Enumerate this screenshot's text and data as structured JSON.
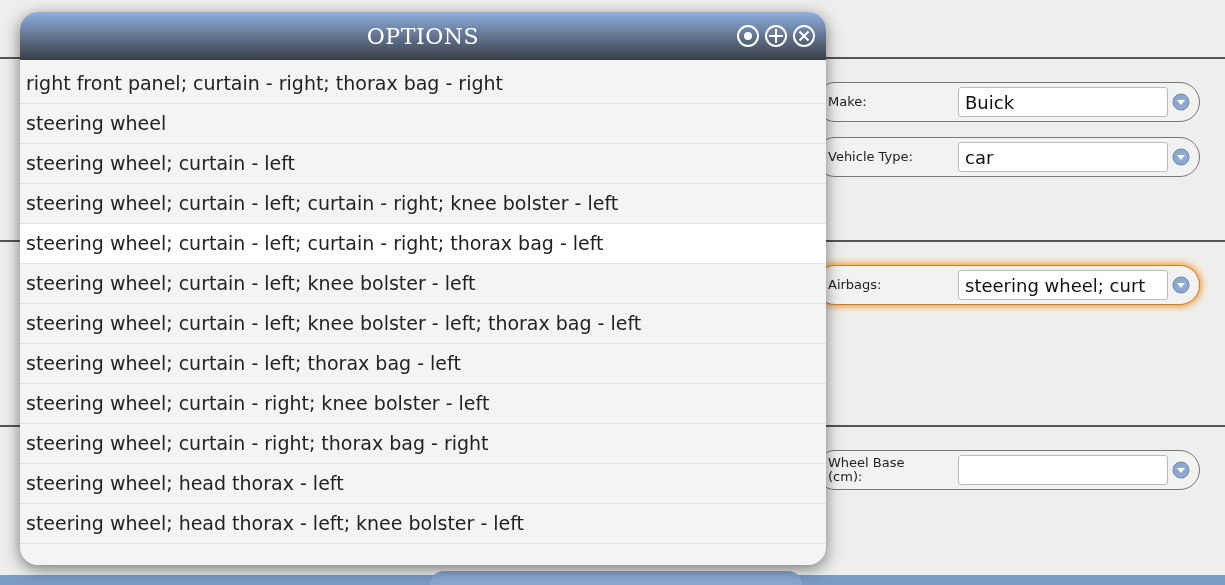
{
  "dialog": {
    "title": "OPTIONS",
    "items": [
      {
        "label": "right front panel; curtain - right; thorax bag - right",
        "selected": false
      },
      {
        "label": "steering wheel",
        "selected": false
      },
      {
        "label": "steering wheel; curtain - left",
        "selected": false
      },
      {
        "label": "steering wheel; curtain - left; curtain - right; knee bolster - left",
        "selected": false
      },
      {
        "label": "steering wheel; curtain - left; curtain - right; thorax bag - left",
        "selected": true
      },
      {
        "label": "steering wheel; curtain - left; knee bolster - left",
        "selected": false
      },
      {
        "label": "steering wheel; curtain - left; knee bolster - left; thorax bag - left",
        "selected": false
      },
      {
        "label": "steering wheel; curtain - left; thorax bag - left",
        "selected": false
      },
      {
        "label": "steering wheel; curtain - right; knee bolster - left",
        "selected": false
      },
      {
        "label": "steering wheel; curtain - right; thorax bag - right",
        "selected": false
      },
      {
        "label": "steering wheel; head thorax - left",
        "selected": false
      },
      {
        "label": "steering wheel; head thorax - left; knee bolster - left",
        "selected": false
      }
    ]
  },
  "sections": [
    {
      "fields": [
        {
          "label": "Make:",
          "value": "Buick",
          "focused": false
        },
        {
          "label": "Vehicle Type:",
          "value": "car",
          "focused": false
        }
      ]
    },
    {
      "fields": [
        {
          "label": "Airbags:",
          "value": "steering wheel; curt",
          "focused": true
        }
      ]
    },
    {
      "fields": [
        {
          "label": "Wheel Base (cm):",
          "focused": false
        }
      ]
    }
  ]
}
